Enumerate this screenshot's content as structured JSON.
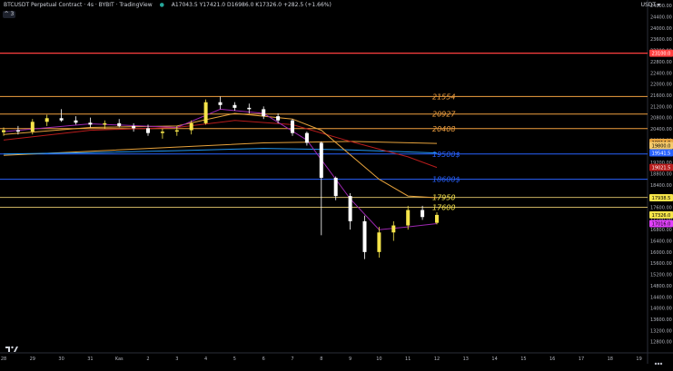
{
  "header": {
    "title": "BTCUSDT Perpetual Contract · 4s · BYBIT · TradingView",
    "ohlc": "A17043.5 Y17421.0 D16986.0 K17326.0 +282.5 (+1.66%)",
    "collapse_label": "^ 3",
    "unit": "USDT ▾"
  },
  "colors": {
    "background": "#000000",
    "bull": "#f5e44a",
    "bear": "#ffffff",
    "level_line": "#f0a040",
    "level_text": "#f0a040",
    "blue_level": "#2962ff",
    "red_level": "#ff4040",
    "ma_orange": "#e6a23c",
    "ma_dark_red": "#b71c1c",
    "ma_blue": "#2196f3",
    "ma_purple": "#9c27b0",
    "ma_khaki": "#c8b400"
  },
  "chart_data": {
    "type": "candlestick",
    "ylim": [
      12400,
      25000
    ],
    "y_ticks": [
      24800,
      24400,
      24000,
      23600,
      23200,
      22800,
      22400,
      22000,
      21600,
      21200,
      20800,
      20400,
      20000,
      19600,
      19200,
      18800,
      18400,
      18000,
      17600,
      17200,
      16800,
      16400,
      16000,
      15600,
      15200,
      14800,
      14400,
      14000,
      13600,
      13200,
      12800
    ],
    "x_ticks": [
      "28",
      "29",
      "30",
      "31",
      "Kas",
      "2",
      "3",
      "4",
      "5",
      "6",
      "7",
      "8",
      "9",
      "10",
      "11",
      "12",
      "13",
      "14",
      "15",
      "16",
      "17",
      "18",
      "19"
    ],
    "candles": [
      {
        "day": 28.0,
        "o": 20280,
        "h": 20450,
        "l": 20150,
        "c": 20350
      },
      {
        "day": 28.5,
        "o": 20350,
        "h": 20500,
        "l": 20200,
        "c": 20300
      },
      {
        "day": 29.0,
        "o": 20300,
        "h": 20750,
        "l": 20200,
        "c": 20650
      },
      {
        "day": 29.5,
        "o": 20650,
        "h": 20900,
        "l": 20500,
        "c": 20780
      },
      {
        "day": 30.0,
        "o": 20780,
        "h": 21100,
        "l": 20650,
        "c": 20700
      },
      {
        "day": 30.5,
        "o": 20700,
        "h": 20850,
        "l": 20550,
        "c": 20620
      },
      {
        "day": 31.0,
        "o": 20620,
        "h": 20800,
        "l": 20450,
        "c": 20550
      },
      {
        "day": 31.5,
        "o": 20550,
        "h": 20700,
        "l": 20400,
        "c": 20600
      },
      {
        "day": 32.0,
        "o": 20600,
        "h": 20750,
        "l": 20450,
        "c": 20500
      },
      {
        "day": 32.5,
        "o": 20500,
        "h": 20600,
        "l": 20300,
        "c": 20420
      },
      {
        "day": 33.0,
        "o": 20420,
        "h": 20550,
        "l": 20150,
        "c": 20250
      },
      {
        "day": 33.5,
        "o": 20250,
        "h": 20400,
        "l": 20050,
        "c": 20300
      },
      {
        "day": 34.0,
        "o": 20300,
        "h": 20500,
        "l": 20150,
        "c": 20350
      },
      {
        "day": 34.5,
        "o": 20350,
        "h": 20700,
        "l": 20200,
        "c": 20600
      },
      {
        "day": 35.0,
        "o": 20600,
        "h": 21450,
        "l": 20550,
        "c": 21350
      },
      {
        "day": 35.5,
        "o": 21350,
        "h": 21550,
        "l": 21100,
        "c": 21250
      },
      {
        "day": 36.0,
        "o": 21250,
        "h": 21350,
        "l": 21050,
        "c": 21150
      },
      {
        "day": 36.5,
        "o": 21150,
        "h": 21300,
        "l": 20950,
        "c": 21100
      },
      {
        "day": 37.0,
        "o": 21100,
        "h": 21200,
        "l": 20750,
        "c": 20850
      },
      {
        "day": 37.5,
        "o": 20850,
        "h": 20950,
        "l": 20600,
        "c": 20700
      },
      {
        "day": 38.0,
        "o": 20700,
        "h": 20750,
        "l": 20150,
        "c": 20250
      },
      {
        "day": 38.5,
        "o": 20250,
        "h": 20300,
        "l": 19800,
        "c": 19900
      },
      {
        "day": 39.0,
        "o": 19900,
        "h": 19950,
        "l": 16600,
        "c": 18650
      },
      {
        "day": 39.5,
        "o": 18650,
        "h": 18700,
        "l": 17850,
        "c": 18000
      },
      {
        "day": 40.0,
        "o": 18000,
        "h": 18100,
        "l": 16800,
        "c": 17100
      },
      {
        "day": 40.5,
        "o": 17100,
        "h": 17300,
        "l": 15750,
        "c": 16000
      },
      {
        "day": 41.0,
        "o": 16000,
        "h": 16900,
        "l": 15800,
        "c": 16700
      },
      {
        "day": 41.5,
        "o": 16700,
        "h": 17100,
        "l": 16400,
        "c": 16950
      },
      {
        "day": 42.0,
        "o": 16950,
        "h": 17650,
        "l": 16800,
        "c": 17500
      },
      {
        "day": 42.5,
        "o": 17500,
        "h": 17650,
        "l": 17150,
        "c": 17250
      },
      {
        "day": 43.0,
        "o": 17043.5,
        "h": 17421,
        "l": 16986,
        "c": 17326
      }
    ],
    "levels": [
      {
        "price": 21554,
        "label": "21554",
        "kind": "orange"
      },
      {
        "price": 20927,
        "label": "20927",
        "kind": "orange"
      },
      {
        "price": 20408,
        "label": "20408",
        "kind": "orange"
      },
      {
        "price": 19500,
        "label": "19500$",
        "kind": "blue"
      },
      {
        "price": 18600,
        "label": "18600$",
        "kind": "blue"
      },
      {
        "price": 17950,
        "label": "17950",
        "kind": "white"
      },
      {
        "price": 17600,
        "label": "17600",
        "kind": "white"
      },
      {
        "price": 23100,
        "label": "",
        "kind": "red"
      }
    ],
    "price_tags": [
      {
        "price": 23100.0,
        "label": "23100.0",
        "bg": "#ff4040",
        "fg": "#ffffff"
      },
      {
        "price": 19914.0,
        "label": "19914.0",
        "bg": "#e6a23c",
        "fg": "#000000"
      },
      {
        "price": 19800.0,
        "label": "19800.0",
        "bg": "#f5c96a",
        "fg": "#000000"
      },
      {
        "price": 19541.5,
        "label": "19541.5",
        "bg": "#2962ff",
        "fg": "#ffffff"
      },
      {
        "price": 19021.5,
        "label": "19021.5",
        "bg": "#b71c1c",
        "fg": "#ffffff"
      },
      {
        "price": 17938.5,
        "label": "17938.5",
        "bg": "#f5e44a",
        "fg": "#000000"
      },
      {
        "price": 17326.0,
        "label": "17326.0",
        "bg": "#f5e44a",
        "fg": "#000000"
      },
      {
        "price": 17016.0,
        "label": "17016.0",
        "bg": "#e040fb",
        "fg": "#000000"
      }
    ],
    "moving_averages": [
      {
        "color": "#e6a23c",
        "points": [
          [
            28.0,
            19450
          ],
          [
            31.0,
            19600
          ],
          [
            34.0,
            19750
          ],
          [
            37.0,
            19900
          ],
          [
            40.0,
            19950
          ],
          [
            43.0,
            19880
          ]
        ]
      },
      {
        "color": "#2196f3",
        "points": [
          [
            28.0,
            19500
          ],
          [
            31.0,
            19550
          ],
          [
            34.0,
            19620
          ],
          [
            37.0,
            19700
          ],
          [
            40.0,
            19650
          ],
          [
            43.0,
            19540
          ]
        ]
      },
      {
        "color": "#b71c1c",
        "points": [
          [
            28.0,
            20000
          ],
          [
            31.0,
            20350
          ],
          [
            34.0,
            20450
          ],
          [
            36.0,
            20700
          ],
          [
            38.0,
            20550
          ],
          [
            40.0,
            19950
          ],
          [
            42.0,
            19400
          ],
          [
            43.0,
            19020
          ]
        ]
      },
      {
        "color": "#e6a23c",
        "points": [
          [
            28.0,
            20200
          ],
          [
            31.0,
            20450
          ],
          [
            34.0,
            20500
          ],
          [
            36.0,
            20950
          ],
          [
            38.0,
            20750
          ],
          [
            39.0,
            20350
          ],
          [
            41.0,
            18600
          ],
          [
            42.0,
            18000
          ],
          [
            43.0,
            17940
          ]
        ]
      },
      {
        "color": "#9c27b0",
        "points": [
          [
            28.0,
            20300
          ],
          [
            31.0,
            20580
          ],
          [
            34.0,
            20450
          ],
          [
            35.5,
            21100
          ],
          [
            37.0,
            20950
          ],
          [
            38.5,
            20000
          ],
          [
            40.0,
            17900
          ],
          [
            41.0,
            16800
          ],
          [
            42.0,
            16900
          ],
          [
            43.0,
            17016
          ]
        ]
      }
    ]
  }
}
